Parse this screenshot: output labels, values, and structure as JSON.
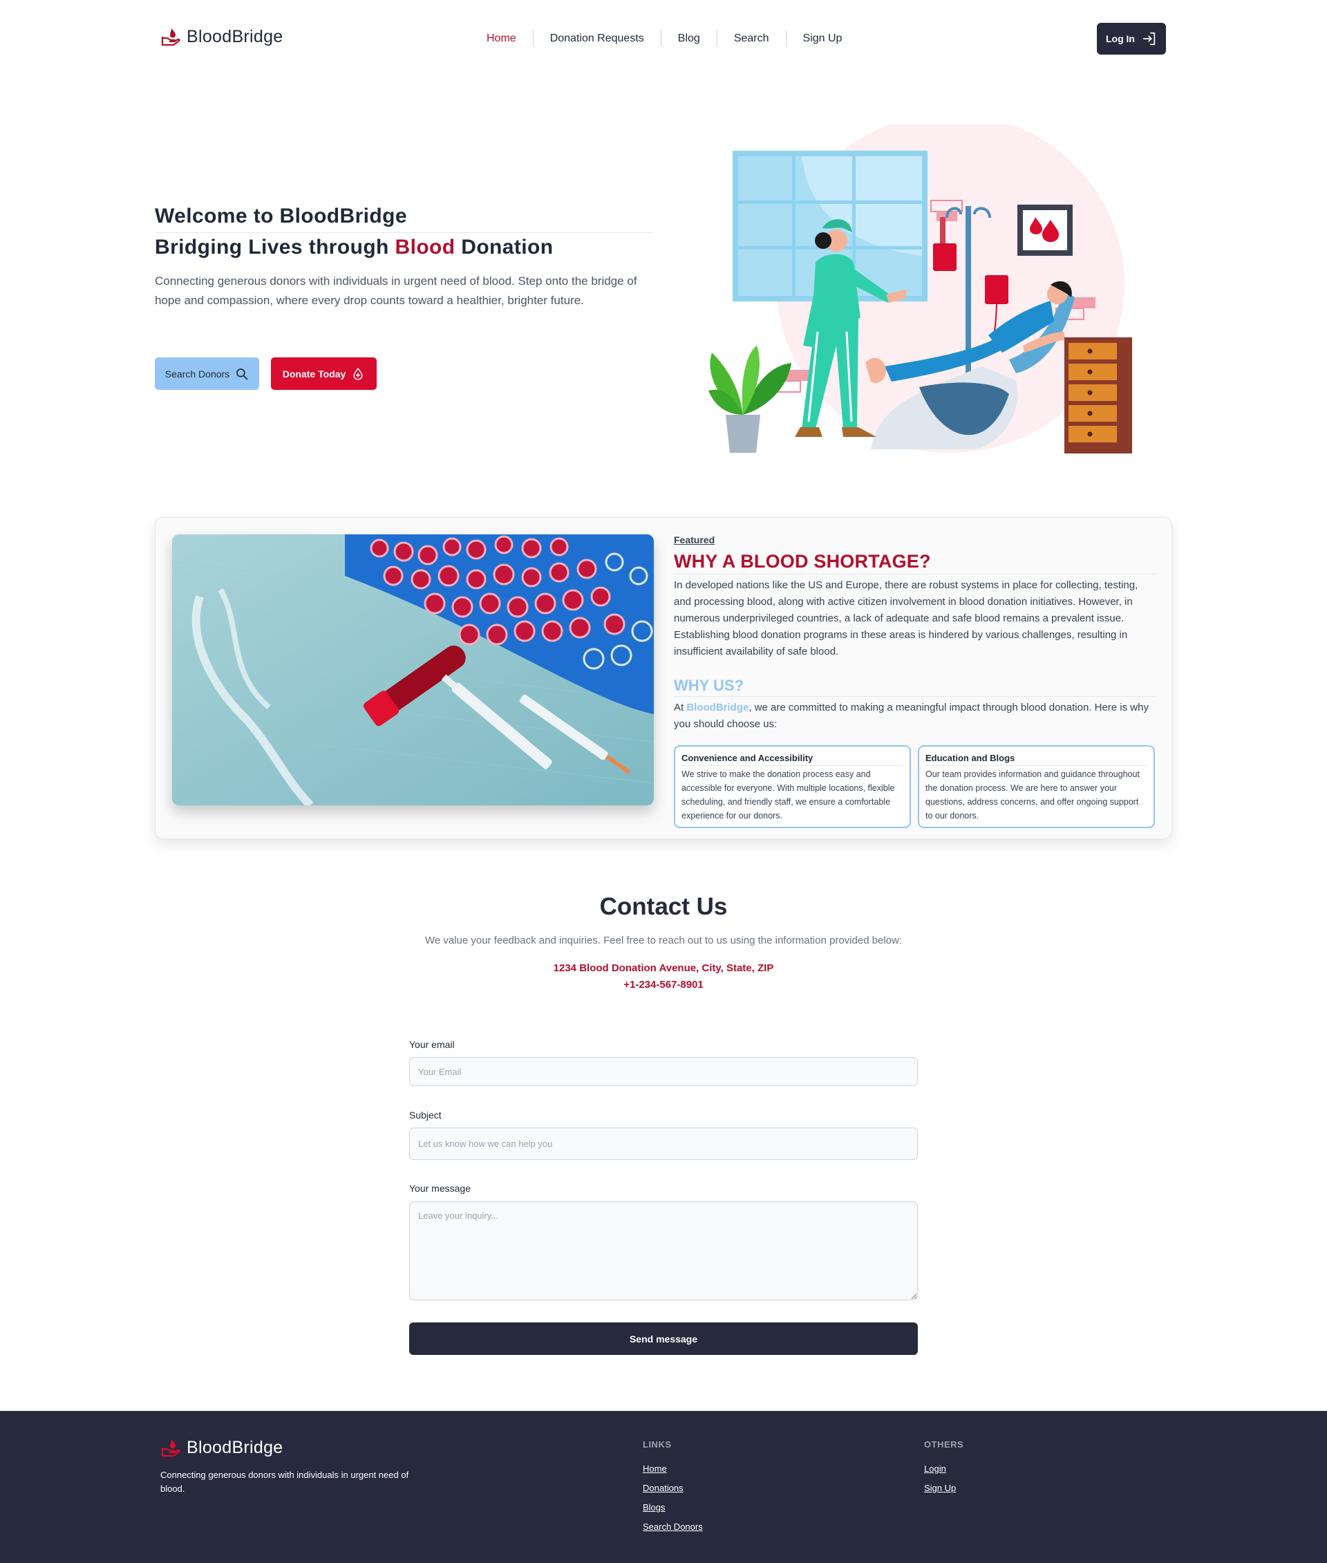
{
  "brand": {
    "name": "BloodBridge",
    "accent": "#b0102e",
    "primary_red": "#d90b2e",
    "light_blue": "#93c5f4",
    "dark": "#262a3c"
  },
  "nav": {
    "items": [
      {
        "label": "Home",
        "active": true
      },
      {
        "label": "Donation Requests"
      },
      {
        "label": "Blog"
      },
      {
        "label": "Search"
      },
      {
        "label": "Sign Up"
      }
    ],
    "login_label": "Log In",
    "login_icon": "log-in-icon"
  },
  "hero": {
    "title": "Welcome to BloodBridge",
    "subtitle_pre": "Bridging Lives through ",
    "subtitle_highlight": "Blood",
    "subtitle_post": " Donation",
    "description": "Connecting generous donors with individuals in urgent need of blood. Step onto the bridge of hope and compassion, where every drop counts toward a healthier, brighter future.",
    "search_button": "Search Donors",
    "search_icon": "search-icon",
    "donate_button": "Donate Today",
    "donate_icon": "blood-drop-icon"
  },
  "featured": {
    "tag": "Featured",
    "title": "WHY A BLOOD SHORTAGE?",
    "text": "In developed nations like the US and Europe, there are robust systems in place for collecting, testing, and processing blood, along with active citizen involvement in blood donation initiatives. However, in numerous underprivileged countries, a lack of adequate and safe blood remains a prevalent issue. Establishing blood donation programs in these areas is hindered by various challenges, resulting in insufficient availability of safe blood.",
    "why_title": "WHY US?",
    "why_pre": "At ",
    "why_brand": "BloodBridge",
    "why_post": ", we are committed to making a meaningful impact through blood donation. Here is why you should choose us:",
    "boxes": [
      {
        "title": "Convenience and Accessibility",
        "text": "We strive to make the donation process easy and accessible for everyone. With multiple locations, flexible scheduling, and friendly staff, we ensure a comfortable experience for our donors."
      },
      {
        "title": "Education and Blogs",
        "text": "Our team provides information and guidance throughout the donation process. We are here to answer your questions, address concerns, and offer ongoing support to our donors."
      }
    ]
  },
  "contact": {
    "title": "Contact Us",
    "description": "We value your feedback and inquiries. Feel free to reach out to us using the information provided below:",
    "address": "1234 Blood Donation Avenue, City, State, ZIP",
    "phone": "+1-234-567-8901",
    "form": {
      "email_label": "Your email",
      "email_placeholder": "Your Email",
      "subject_label": "Subject",
      "subject_placeholder": "Let us know how we can help you",
      "message_label": "Your message",
      "message_placeholder": "Leave your inquiry...",
      "submit_label": "Send message"
    }
  },
  "footer": {
    "brand": "BloodBridge",
    "description": "Connecting generous donors with individuals in urgent need of blood.",
    "links_heading": "LINKS",
    "links": [
      "Home",
      "Donations",
      "Blogs",
      "Search Donors"
    ],
    "others_heading": "OTHERS",
    "others": [
      "Login",
      "Sign Up"
    ]
  }
}
